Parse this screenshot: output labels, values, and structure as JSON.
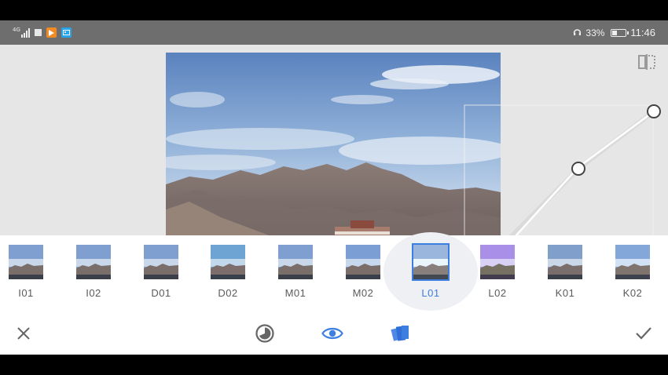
{
  "status_bar": {
    "network_label": "4G",
    "battery_percent": "33%",
    "time": "11:46",
    "battery_level": 0.33,
    "icons": [
      "signal-icon",
      "notification-square-icon",
      "video-app-icon",
      "gallery-app-icon",
      "headset-icon",
      "battery-icon"
    ]
  },
  "editor": {
    "compare_icon": "compare-split-icon",
    "curve_tool": "tone-curve",
    "colors": {
      "accent": "#3d7fe0",
      "sky_top": "#5b83bf",
      "mountain": "#8a7d77"
    }
  },
  "filters": {
    "selected": "L01",
    "items": [
      {
        "label": "I01"
      },
      {
        "label": "I02"
      },
      {
        "label": "D01"
      },
      {
        "label": "D02"
      },
      {
        "label": "M01"
      },
      {
        "label": "M02"
      },
      {
        "label": "L01"
      },
      {
        "label": "L02"
      },
      {
        "label": "K01"
      },
      {
        "label": "K02"
      }
    ]
  },
  "toolbar": {
    "icons": [
      "close-icon",
      "tone-dial-icon",
      "eye-icon",
      "styles-icon",
      "check-icon"
    ]
  }
}
